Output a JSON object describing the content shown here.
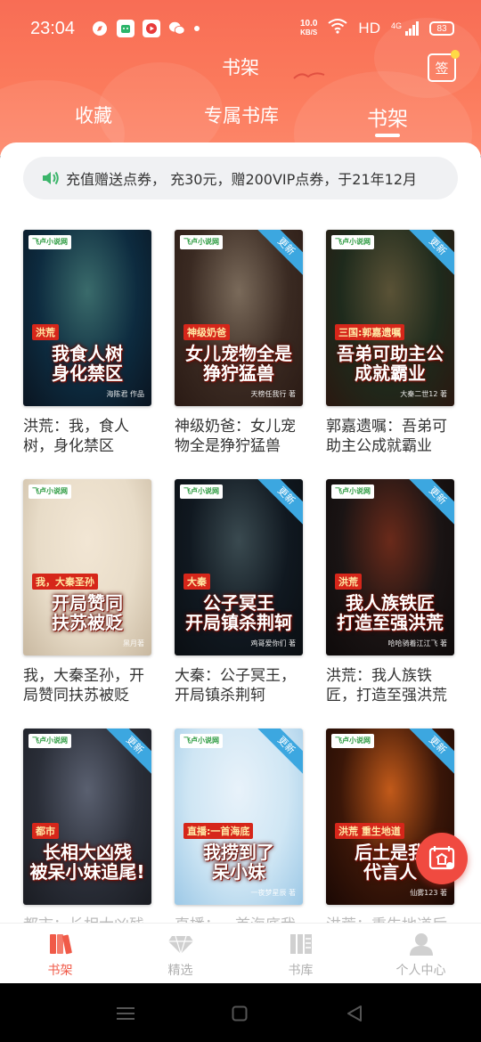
{
  "status": {
    "time": "23:04",
    "net_speed_value": "10.0",
    "net_speed_unit": "KB/S",
    "hd": "HD",
    "signal": "4G",
    "battery": "83"
  },
  "header": {
    "title": "书架",
    "sign_label": "签"
  },
  "tabs": [
    {
      "label": "收藏"
    },
    {
      "label": "专属书库"
    },
    {
      "label": "书架"
    }
  ],
  "notice": {
    "text": "充值赠送点券， 充30元，赠200VIP点券，于21年12月"
  },
  "books": [
    {
      "title": "洪荒：我，食人树，身化禁区",
      "cover_text": "我食人树\n身化禁区",
      "tag": "洪荒",
      "author": "海陈君 作品",
      "badge": "",
      "palette": [
        "#0d2b3f",
        "#3a6b6b",
        "#0a1420"
      ],
      "logo": "飞卢小说网"
    },
    {
      "title": "神级奶爸：女儿宠物全是狰狞猛兽",
      "cover_text": "女儿宠物全是\n狰狞猛兽",
      "tag": "神级奶爸",
      "author": "天榜任我行 著",
      "badge": "更新",
      "palette": [
        "#3a2a22",
        "#7a6a5a",
        "#2a1a14"
      ],
      "logo": "飞卢小说网"
    },
    {
      "title": "郭嘉遗嘱：吾弟可助主公成就霸业",
      "cover_text": "吾弟可助主公\n成就霸业",
      "tag": "三国:郭嘉遗嘱",
      "author": "大秦二世12 著",
      "badge": "更新",
      "palette": [
        "#1e2a1c",
        "#5a5236",
        "#2a1810"
      ],
      "logo": "飞卢小说网"
    },
    {
      "title": "我，大秦圣孙，开局赞同扶苏被贬",
      "cover_text": "开局赞同\n扶苏被贬",
      "tag": "我，大秦圣孙",
      "author": "黑月著",
      "badge": "",
      "palette": [
        "#e8dcc8",
        "#f2e6d4",
        "#c8b8a0"
      ],
      "logo": "飞卢小说网"
    },
    {
      "title": "大秦：公子冥王，开局镇杀荆轲",
      "cover_text": "公子冥王\n开局镇杀荆轲",
      "tag": "大秦",
      "author": "鸡哥爱你们 著",
      "badge": "更新",
      "palette": [
        "#101820",
        "#3a4a50",
        "#0a0e12"
      ],
      "logo": "飞卢小说网"
    },
    {
      "title": "洪荒：我人族铁匠，打造至强洪荒",
      "cover_text": "我人族铁匠\n打造至强洪荒",
      "tag": "洪荒",
      "author": "哈哈骑着江江飞 著",
      "badge": "更新",
      "palette": [
        "#1a1414",
        "#6a2a1a",
        "#0e0a0a"
      ],
      "logo": "飞卢小说网"
    },
    {
      "title": "都市：长相大凶残被呆小妹追尾",
      "cover_text": "长相大凶残\n被呆小妹追尾!",
      "tag": "都市",
      "author": "",
      "badge": "更新",
      "palette": [
        "#2a2e38",
        "#5a6070",
        "#1a1c22"
      ],
      "logo": "飞卢小说网"
    },
    {
      "title": "直播：一首海底我捞到了呆小妹",
      "cover_text": "我捞到了\n呆小妹",
      "tag": "直播:一首海底",
      "author": "一夜梦星辰 著",
      "badge": "更新",
      "palette": [
        "#cfe6f4",
        "#e8f2fa",
        "#9cc8e6"
      ],
      "logo": "飞卢小说网"
    },
    {
      "title": "洪荒：重生地道后土是我代言人",
      "cover_text": "后土是我\n代言人",
      "tag": "洪荒 重生地道",
      "author": "仙雾123 著",
      "badge": "更新",
      "palette": [
        "#3a1608",
        "#c25a1a",
        "#1a0804"
      ],
      "logo": "飞卢小说网"
    }
  ],
  "tabbar": [
    {
      "label": "书架",
      "icon": "bookshelf-icon",
      "active": true
    },
    {
      "label": "精选",
      "icon": "diamond-icon",
      "active": false
    },
    {
      "label": "书库",
      "icon": "library-icon",
      "active": false
    },
    {
      "label": "个人中心",
      "icon": "person-icon",
      "active": false
    }
  ],
  "colors": {
    "accent": "#f05a48",
    "header": "#f86d55",
    "ribbon": "#3ca7e0"
  }
}
